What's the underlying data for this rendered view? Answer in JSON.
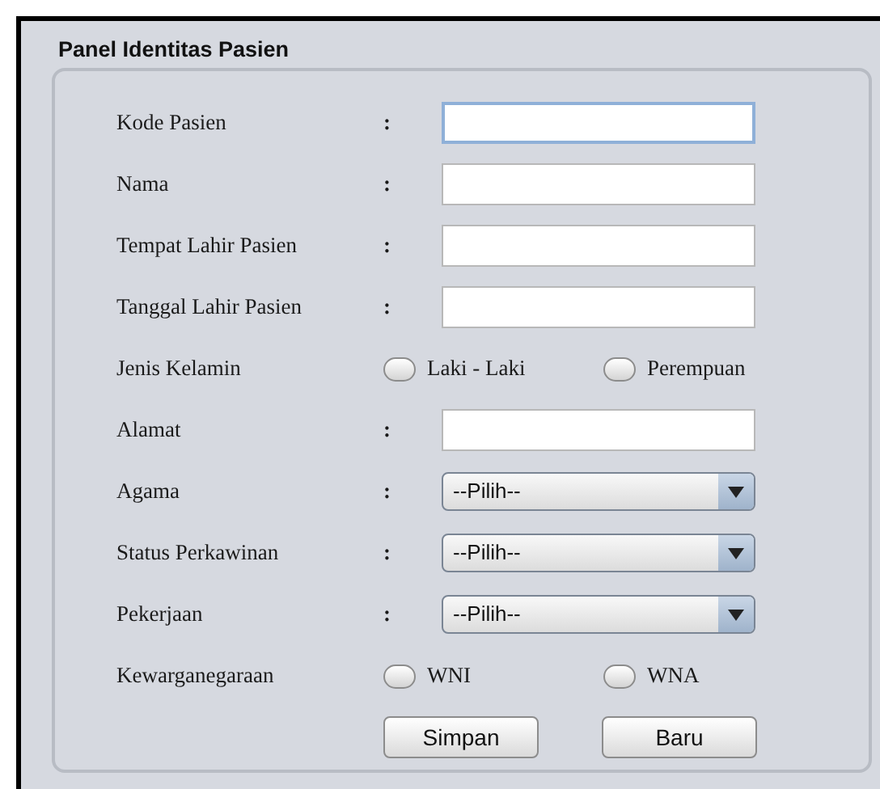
{
  "panel": {
    "title": "Panel Identitas Pasien"
  },
  "rows": [
    {
      "kind": "text",
      "label": "Kode Pasien",
      "colon": ":",
      "focused": true
    },
    {
      "kind": "text",
      "label": "Nama",
      "colon": ":",
      "focused": false
    },
    {
      "kind": "text",
      "label": "Tempat Lahir Pasien",
      "colon": ":",
      "focused": false
    },
    {
      "kind": "text",
      "label": "Tanggal Lahir Pasien",
      "colon": ":",
      "focused": false
    },
    {
      "kind": "radio",
      "label": "Jenis Kelamin",
      "options": [
        {
          "label": "Laki - Laki",
          "selected": false
        },
        {
          "label": "Perempuan",
          "selected": false
        }
      ]
    },
    {
      "kind": "text",
      "label": "Alamat",
      "colon": ":",
      "focused": false
    },
    {
      "kind": "select",
      "label": "Agama",
      "colon": ":",
      "value": "--Pilih--"
    },
    {
      "kind": "select",
      "label": "Status Perkawinan",
      "colon": ":",
      "value": "--Pilih--"
    },
    {
      "kind": "select",
      "label": "Pekerjaan",
      "colon": ":",
      "value": "--Pilih--"
    },
    {
      "kind": "radio",
      "label": "Kewarganegaraan",
      "options": [
        {
          "label": "WNI",
          "selected": false
        },
        {
          "label": "WNA",
          "selected": false
        }
      ]
    }
  ],
  "buttons": [
    "Simpan",
    "Baru"
  ]
}
